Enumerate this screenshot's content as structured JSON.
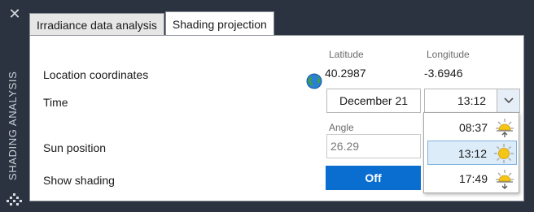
{
  "side_panel": {
    "title": "SHADING ANALYSIS",
    "close_icon": "close-icon",
    "grip_icon": "grip-icon"
  },
  "tabs": [
    {
      "label": "Irradiance data analysis",
      "active": false
    },
    {
      "label": "Shading projection",
      "active": true
    }
  ],
  "location": {
    "label": "Location coordinates",
    "latitude_label": "Latitude",
    "latitude": "40.2987",
    "longitude_label": "Longitude",
    "longitude": "-3.6946",
    "icon": "globe-icon"
  },
  "time": {
    "label": "Time",
    "date": "December 21",
    "selected_time": "13:12",
    "options": [
      {
        "time": "08:37",
        "icon": "sunrise-icon"
      },
      {
        "time": "13:12",
        "icon": "sun-icon",
        "selected": true
      },
      {
        "time": "17:49",
        "icon": "sunset-icon"
      }
    ]
  },
  "sun_position": {
    "label": "Sun position",
    "angle_label": "Angle",
    "angle_value": "26.29"
  },
  "shading": {
    "label": "Show shading",
    "toggle_label": "Off"
  },
  "colors": {
    "accent": "#0a6ed1",
    "sun": "#f5c518",
    "panel_bg": "#2b3340"
  }
}
